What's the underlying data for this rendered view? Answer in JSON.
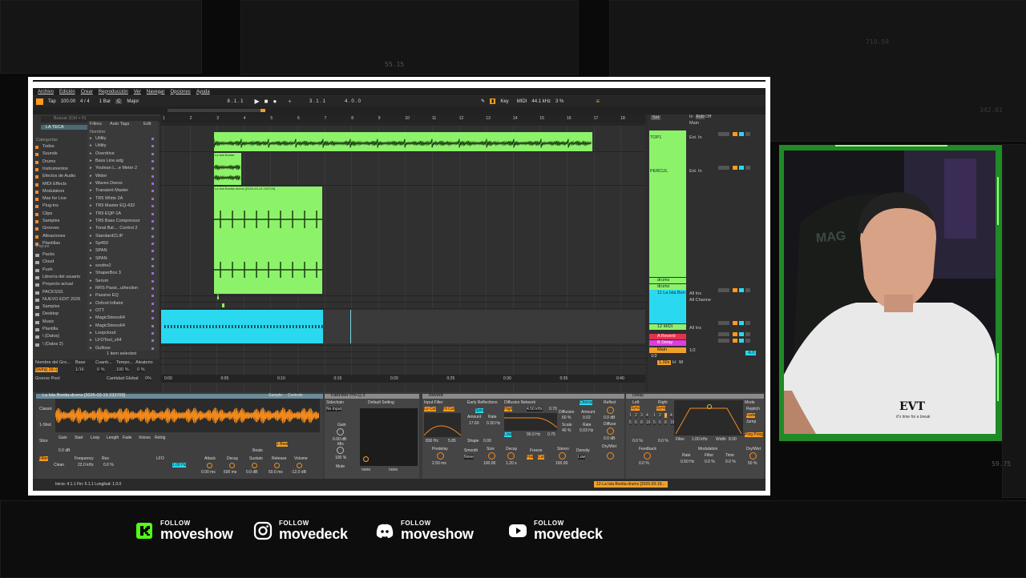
{
  "background": {
    "labels": [
      "55.15",
      "719.59",
      "342.81",
      "59.75"
    ]
  },
  "daw": {
    "menu": [
      "Archivo",
      "Edición",
      "Crear",
      "Reproducción",
      "Ver",
      "Navegar",
      "Opciones",
      "Ayuda"
    ],
    "transport": {
      "tap": "Tap",
      "tempo": "100.00",
      "signature": "4 / 4",
      "metro": "1 Bar",
      "key": "C",
      "scale": "Major",
      "position": "8 .  1 .  1",
      "loop_start": "3 .  1 .  1",
      "loop_len": "4 .  0 .  0",
      "key_label": "Key",
      "midi_label": "MIDI",
      "sample_rate": "44.1 kHz",
      "cpu": "3 %"
    },
    "browser": {
      "search_placeholder": "Buscar (Ctrl + F)",
      "collection": "LA TECA",
      "categories_title": "Categorías",
      "categories": [
        "Todos",
        "Sounds",
        "Drums",
        "Instrumentos",
        "Efectos de Audio",
        "MIDI Effects",
        "Modulators",
        "Max for Live",
        "Plug-ins",
        "Clips",
        "Samples",
        "Grooves",
        "Afinaciones",
        "Plantillas"
      ],
      "places_title": "Places",
      "places": [
        "Packs",
        "Cloud",
        "Push",
        "Librería del usuario",
        "Proyecto actual",
        "PACKSSS",
        "NUEVO EDIT 2026",
        "Samples",
        "Desktop",
        "Music",
        "Plantilla",
        "\\ (Datos)",
        "\\ (Datos 2)"
      ],
      "filter_label": "Filtros",
      "autotag_label": "Auto Tags",
      "edit_label": "Edit",
      "column_header": "Nombre",
      "items": [
        "Utility",
        "Utility",
        "Overdrive",
        "Bass Line.adg",
        "Youlean L...e Meter 2",
        "Wider",
        "Waves Deess",
        "Transient Master",
        "TR5 White 2A",
        "TR5 Master EQ-432",
        "TR5 EQP-1A",
        "TR5 Bass Compressor",
        "Tonal Bal.... Control 2",
        "StandardCLIP",
        "Sp450",
        "SPAN",
        "SPAN",
        "soothe2",
        "ShaperBox 3",
        "Serum",
        "RRS Passi...ulhection",
        "Passive EQ",
        "Oxford Inflator",
        "OTT",
        "MagicStereo64",
        "MagicStereo64",
        "Loopcloud",
        "LFOTool_x64",
        "Gulfoss"
      ],
      "selected_text": "1 item selected",
      "groove_headers": [
        "Nombre del Gro...",
        "Base",
        "Cuanti...",
        "Tempo...",
        "Aleatorio"
      ],
      "groove_row": [
        "Swing 16-1",
        "1/16",
        "0 %",
        "100 %",
        "0 %"
      ],
      "groove_pool": "Groove Pool",
      "groove_amount_label": "Cantidad Global",
      "groove_amount": "0%"
    },
    "ruler": [
      "1",
      "2",
      "3",
      "4",
      "5",
      "6",
      "7",
      "8",
      "9",
      "10",
      "11",
      "12",
      "13",
      "14",
      "15",
      "16",
      "17",
      "18"
    ],
    "time_ruler": [
      "0:00",
      "0:05",
      "0:10",
      "0:15",
      "0:20",
      "0:25",
      "0:30",
      "0:35",
      "0:40"
    ],
    "clips": {
      "clip2": "La Isla Bonita",
      "clip3": "La Isla Bonita-drums [2026-03-19 233709]"
    },
    "tracks": {
      "set_label": "Set",
      "names": [
        "TOP1",
        "PERCUL",
        "drums",
        "drums",
        "11 La Isla Bon",
        "12 MIDI",
        "A Reverb",
        "B Delay",
        "Main"
      ],
      "input_labels": [
        "Ext. In",
        "All Ins",
        "All Channe",
        "Main"
      ],
      "in_auto_off": [
        "In",
        "Auto",
        "Off"
      ],
      "page": "1/2",
      "master_value": "-6.0",
      "master_level": "1.00s",
      "sel_buttons": [
        "H",
        "W"
      ]
    },
    "devices": {
      "clip_name": "La Isla Bonita-drums [2026-03-19 233709]",
      "sample_tab": "Sample",
      "controls_tab": "Controls",
      "classic": "Classic",
      "oneshot": "1-Shot",
      "slice": "Slice",
      "clip_params": [
        "Gain",
        "Start",
        "Loop",
        "Length",
        "Fade",
        "Voices",
        "Retrig"
      ],
      "clip_values": [
        "0.0 dB",
        "0.0 dB",
        "1 Beat",
        "Beats"
      ],
      "filter_label": "Filter",
      "filter_type": "Clean",
      "freq_label": "Frequency",
      "res_label": "Res",
      "freq_val": "22.0 kHz",
      "res_val": "0.0 %",
      "lfo": "LFO",
      "lfo_rate": "1.00 Hz",
      "env_labels": [
        "Attack",
        "Decay",
        "Sustain",
        "Release",
        "Volume"
      ],
      "env_values": [
        "0.00 ms",
        "600 ms",
        "0.0 dB",
        "50.0 ms",
        "-12.0 dB"
      ],
      "fabfilter": "FabFilter Pro-Q 3",
      "sidechain": "Sidechain",
      "no_input": "No Input",
      "default_setting": "Default Setting",
      "gain": "Gain",
      "gain_val": "0.00 dB",
      "mix": "Mix",
      "mix_val": "100 %",
      "mute": "Mute",
      "none": [
        "none",
        "none"
      ],
      "reverb": "Reverb",
      "input_filter": "Input Filter",
      "lo_cut": "Lo Cut",
      "hi_cut": "Hi Cut",
      "freq_in": "830 Hz",
      "width_in": "5.85",
      "early_ref": "Early Reflections",
      "spin": "Spin",
      "amount_label": "Amount",
      "rate_label": "Rate",
      "early_amount": "17.60",
      "early_rate": "0.30 Hz",
      "shape_label": "Shape",
      "shape_val": "0.00",
      "diffusion": "Diffusion Network",
      "high": "High",
      "hi_freq": "4.50 kHz",
      "hi_val": "0.70",
      "low": "Low",
      "lo_freq": "90.0 Hz",
      "lo_val": "0.75",
      "chorus": "Chorus",
      "chorus_amount": "0.02",
      "chorus_rate": "0.03 Hz",
      "diffusion_label": "Diffusion",
      "diffusion_val": "60 %",
      "scale_label": "Scale",
      "scale_val": "40 %",
      "reflect": "Reflect",
      "reflect_val": "0.0 dB",
      "diffuse": "Diffuse",
      "diffuse_val": "0.0 dB",
      "predelay": "Predelay",
      "predelay_val": "2.50 ms",
      "smooth": "Smooth",
      "smooth_val": "None",
      "size": "Size",
      "size_val": "100.00",
      "decay": "Decay",
      "decay_val": "1.20 s",
      "freeze": "Freeze",
      "flat": "Flat",
      "cut": "Cut",
      "stereo": "Stereo",
      "stereo_val": "100.00",
      "density": "Density",
      "density_val": "Low",
      "drywet": "Dry/Wet",
      "delay": "Delay",
      "left": "Left",
      "right": "Right",
      "sync": "Sync",
      "delay_grid": [
        "1",
        "2",
        "3",
        "4",
        "5",
        "6",
        "8",
        "16"
      ],
      "delay_l_val": "0.0 %",
      "delay_r_val": "0.0 %",
      "feedback": "Feedback",
      "feedback_val": "0.0 %",
      "delay_filter": "Filter",
      "filter_freq": "1.00 kHz",
      "width_label": "Width",
      "width_val": "8.00",
      "modulation": "Modulation",
      "mod_rate": "Rate",
      "mod_filter": "Filter",
      "mod_time": "Time",
      "mod_rate_val": "0.50 Hz",
      "mod_filter_val": "0.0 %",
      "mod_time_val": "0.0 %",
      "mode": "Mode",
      "repitch": "Repitch",
      "fade": "Fade",
      "jump": "Jump",
      "pingpong": "Ping Pong",
      "drywet_val": "50 %"
    },
    "status": {
      "info": "Inicio: 4.1.1  Fin: 5.1.1  Longitud: 1.0.0",
      "clip_sel": "12-La Isla Bonita-drums [2026-03-19..."
    }
  },
  "webcam": {
    "chair_text": "MAG",
    "shirt_text": "EVT",
    "shirt_sub": "It's time for a break"
  },
  "social": [
    {
      "follow": "FOLLOW",
      "handle": "moveshow",
      "platform": "kick"
    },
    {
      "follow": "FOLLOW",
      "handle": "movedeck",
      "platform": "instagram"
    },
    {
      "follow": "FOLLOW",
      "handle": "moveshow",
      "platform": "discord"
    },
    {
      "follow": "FOLLOW",
      "handle": "movedeck",
      "platform": "youtube"
    }
  ],
  "colors": {
    "clip_green": "#8cf26a",
    "clip_cyan": "#2ad9f0",
    "accent_orange": "#ff9a1f",
    "cam_border": "#1f8a26",
    "kick_green": "#53fc18"
  }
}
